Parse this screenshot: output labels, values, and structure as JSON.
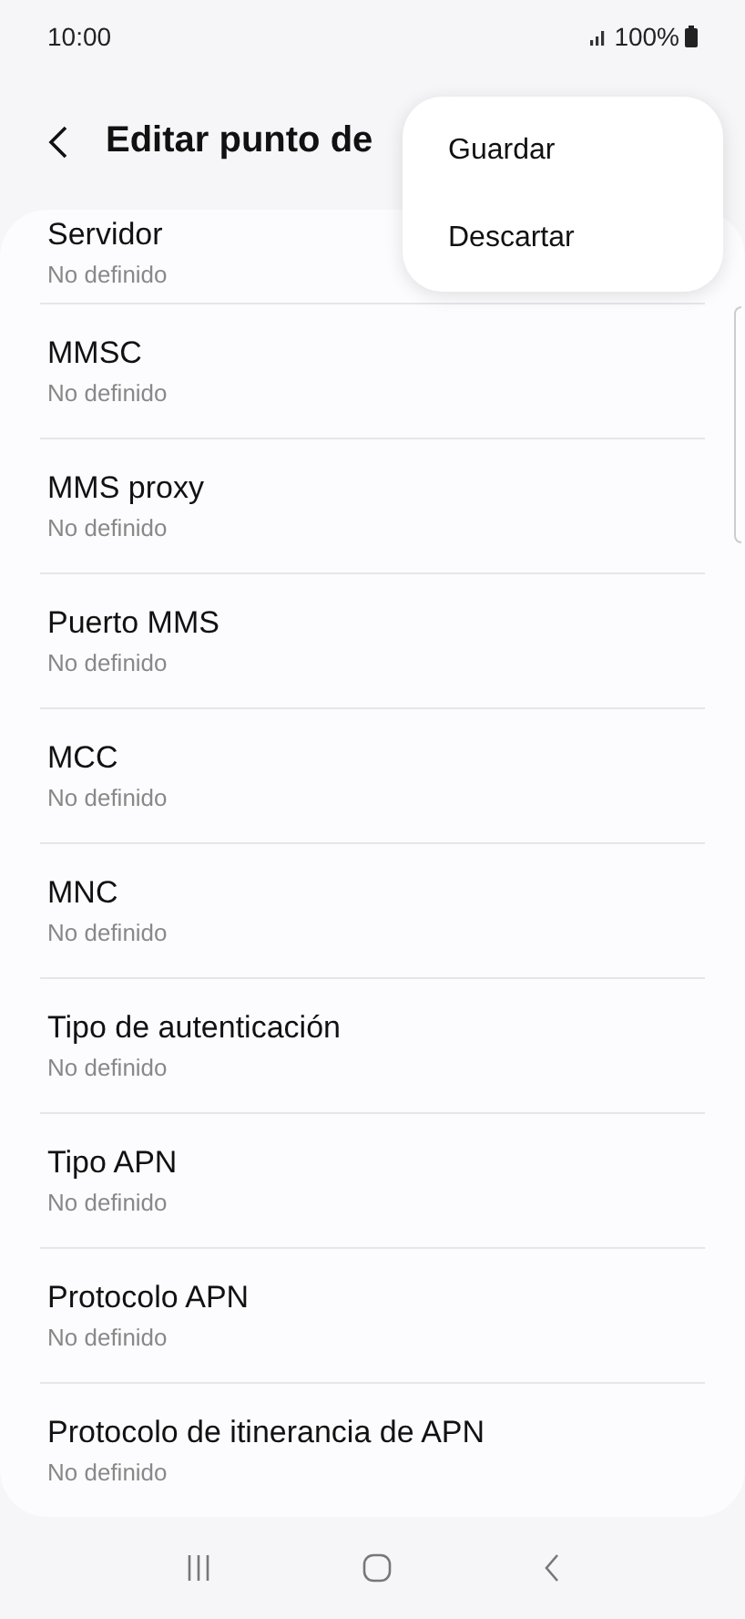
{
  "status_bar": {
    "time": "10:00",
    "battery": "100%"
  },
  "header": {
    "title": "Editar punto de"
  },
  "menu": {
    "items": [
      {
        "label": "Guardar"
      },
      {
        "label": "Descartar"
      }
    ]
  },
  "settings": [
    {
      "title": "Servidor",
      "value": "No definido"
    },
    {
      "title": "MMSC",
      "value": "No definido"
    },
    {
      "title": "MMS proxy",
      "value": "No definido"
    },
    {
      "title": "Puerto MMS",
      "value": "No definido"
    },
    {
      "title": "MCC",
      "value": "No definido"
    },
    {
      "title": "MNC",
      "value": "No definido"
    },
    {
      "title": "Tipo de autenticación",
      "value": "No definido"
    },
    {
      "title": "Tipo APN",
      "value": "No definido"
    },
    {
      "title": "Protocolo APN",
      "value": "No definido"
    },
    {
      "title": "Protocolo de itinerancia de APN",
      "value": "No definido"
    }
  ]
}
